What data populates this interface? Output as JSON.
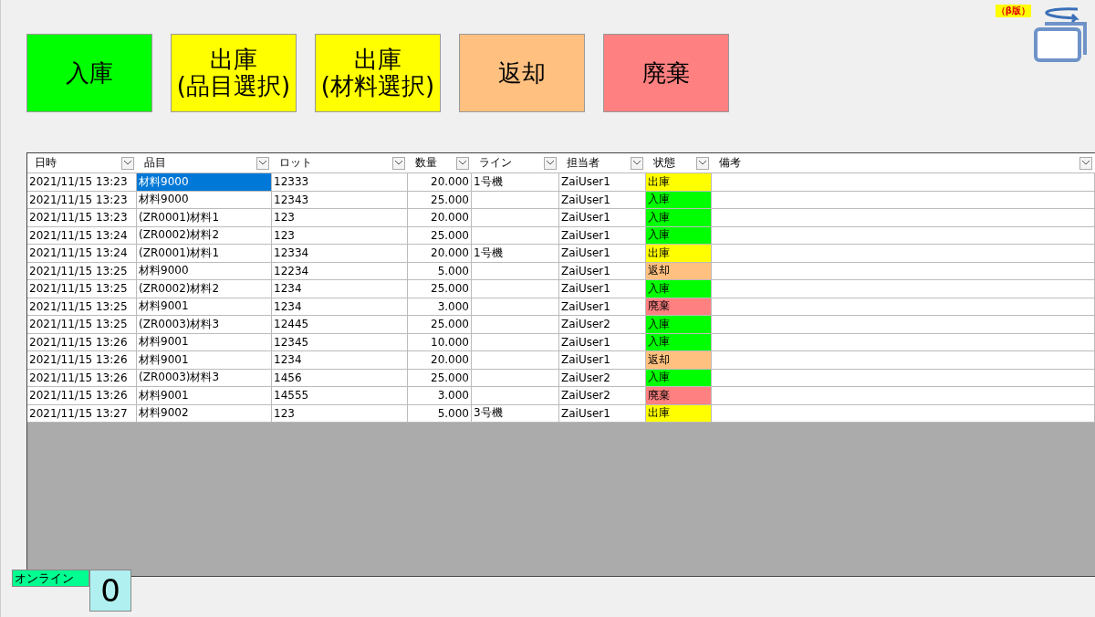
{
  "actions": [
    {
      "label": "入庫",
      "color": "#00ff00"
    },
    {
      "label": "出庫\n(品目選択)",
      "color": "#ffff00"
    },
    {
      "label": "出庫\n(材料選択)",
      "color": "#ffff00"
    },
    {
      "label": "返却",
      "color": "#ffc080"
    },
    {
      "label": "廃棄",
      "color": "#ff8080"
    }
  ],
  "badge": "（β版）",
  "table": {
    "columns": [
      "日時",
      "品目",
      "ロット",
      "数量",
      "ライン",
      "担当者",
      "状態",
      "備考"
    ],
    "rows": [
      {
        "time": "2021/11/15 13:23",
        "item": "材料9000",
        "lot": "12333",
        "qty": "20.000",
        "line": "1号機",
        "user": "ZaiUser1",
        "status": "出庫",
        "color": "#ffff00",
        "selected": true
      },
      {
        "time": "2021/11/15 13:23",
        "item": "材料9000",
        "lot": "12343",
        "qty": "25.000",
        "user": "ZaiUser1",
        "status": "入庫",
        "color": "#00ff00",
        "selected": false
      },
      {
        "time": "2021/11/15 13:23",
        "item": "(ZR0001)材料1",
        "lot": "123",
        "qty": "20.000",
        "user": "ZaiUser1",
        "status": "入庫",
        "color": "#00ff00",
        "selected": false
      },
      {
        "time": "2021/11/15 13:24",
        "item": "(ZR0002)材料2",
        "lot": "123",
        "qty": "25.000",
        "user": "ZaiUser1",
        "status": "入庫",
        "color": "#00ff00",
        "selected": false
      },
      {
        "time": "2021/11/15 13:24",
        "item": "(ZR0001)材料1",
        "lot": "12334",
        "qty": "20.000",
        "line": "1号機",
        "user": "ZaiUser1",
        "status": "出庫",
        "color": "#ffff00",
        "selected": false
      },
      {
        "time": "2021/11/15 13:25",
        "item": "材料9000",
        "lot": "12234",
        "qty": "5.000",
        "user": "ZaiUser1",
        "status": "返却",
        "color": "#ffc080",
        "selected": false
      },
      {
        "time": "2021/11/15 13:25",
        "item": "(ZR0002)材料2",
        "lot": "1234",
        "qty": "25.000",
        "user": "ZaiUser1",
        "status": "入庫",
        "color": "#00ff00",
        "selected": false
      },
      {
        "time": "2021/11/15 13:25",
        "item": "材料9001",
        "lot": "1234",
        "qty": "3.000",
        "user": "ZaiUser1",
        "status": "廃棄",
        "color": "#ff8080",
        "selected": false
      },
      {
        "time": "2021/11/15 13:25",
        "item": "(ZR0003)材料3",
        "lot": "12445",
        "qty": "25.000",
        "user": "ZaiUser2",
        "status": "入庫",
        "color": "#00ff00",
        "selected": false
      },
      {
        "time": "2021/11/15 13:26",
        "item": "材料9001",
        "lot": "12345",
        "qty": "10.000",
        "user": "ZaiUser1",
        "status": "入庫",
        "color": "#00ff00",
        "selected": false
      },
      {
        "time": "2021/11/15 13:26",
        "item": "材料9001",
        "lot": "1234",
        "qty": "20.000",
        "user": "ZaiUser1",
        "status": "返却",
        "color": "#ffc080",
        "selected": false
      },
      {
        "time": "2021/11/15 13:26",
        "item": "(ZR0003)材料3",
        "lot": "1456",
        "qty": "25.000",
        "user": "ZaiUser2",
        "status": "入庫",
        "color": "#00ff00",
        "selected": false
      },
      {
        "time": "2021/11/15 13:26",
        "item": "材料9001",
        "lot": "14555",
        "qty": "3.000",
        "user": "ZaiUser2",
        "status": "廃棄",
        "color": "#ff8080",
        "selected": false
      },
      {
        "time": "2021/11/15 13:27",
        "item": "材料9002",
        "lot": "123",
        "qty": "5.000",
        "line": "3号機",
        "user": "ZaiUser1",
        "status": "出庫",
        "color": "#ffff00",
        "selected": false
      }
    ]
  },
  "online": {
    "label": "オンライン",
    "count": "0"
  }
}
